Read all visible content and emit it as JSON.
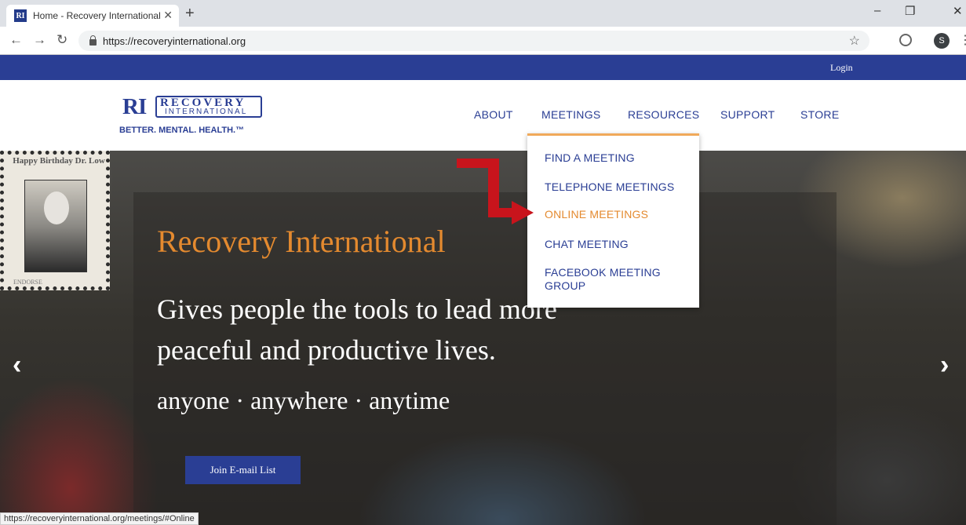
{
  "browser": {
    "tab_title": "Home - Recovery International",
    "favicon_text": "RI",
    "url": "https://recoveryinternational.org",
    "status_url": "https://recoveryinternational.org/meetings/#Online",
    "profile_initial": "S"
  },
  "site": {
    "login": "Login",
    "logo": {
      "ri": "RI",
      "recovery": "RECOVERY",
      "international": "INTERNATIONAL",
      "tagline": "BETTER. MENTAL. HEALTH.™"
    },
    "nav": [
      "ABOUT",
      "MEETINGS",
      "RESOURCES",
      "SUPPORT",
      "STORE"
    ],
    "dropdown": [
      "FIND A MEETING",
      "TELEPHONE MEETINGS",
      "ONLINE MEETINGS",
      "CHAT MEETING",
      "FACEBOOK MEETING GROUP"
    ],
    "hero": {
      "birthday_sign": "Happy Birthday Dr. Low",
      "endorse": "ENDORSE",
      "title": "Recovery International",
      "subtitle": "Gives people the tools to lead more peaceful and productive lives.",
      "tagline": "anyone · anywhere · anytime",
      "button": "Join E-mail List"
    }
  },
  "colors": {
    "brand_blue": "#2a3e94",
    "accent_orange": "#e48a2f",
    "annotation_red": "#c8141c"
  },
  "icons": [
    "back-arrow-icon",
    "forward-arrow-icon",
    "reload-icon",
    "lock-icon",
    "star-icon",
    "extension-icon",
    "menu-icon",
    "carousel-prev-icon",
    "carousel-next-icon"
  ]
}
